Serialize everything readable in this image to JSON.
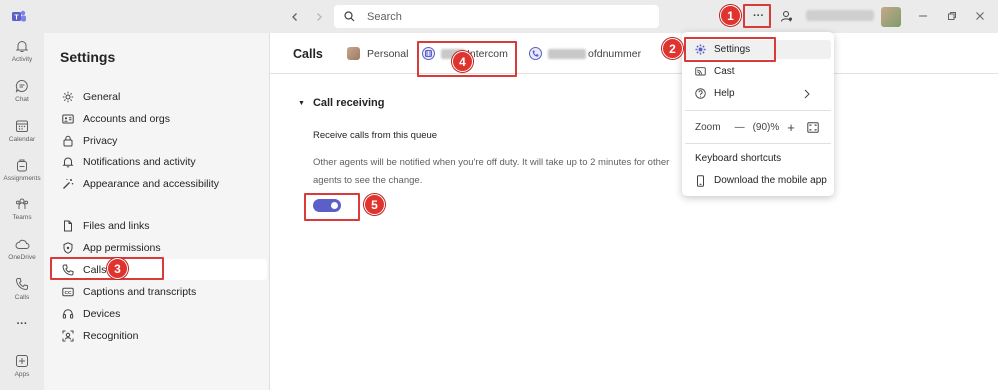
{
  "topbar": {
    "search_placeholder": "Search",
    "more_label": "···"
  },
  "rail": [
    {
      "label": "Activity"
    },
    {
      "label": "Chat"
    },
    {
      "label": "Calendar"
    },
    {
      "label": "Assignments"
    },
    {
      "label": "Teams"
    },
    {
      "label": "OneDrive"
    },
    {
      "label": "Calls"
    },
    {
      "label": "···"
    },
    {
      "label": "Apps"
    }
  ],
  "sidebar": {
    "title": "Settings",
    "items": [
      {
        "label": "General",
        "icon": "gear-icon"
      },
      {
        "label": "Accounts and orgs",
        "icon": "id-card-icon"
      },
      {
        "label": "Privacy",
        "icon": "lock-icon"
      },
      {
        "label": "Notifications and activity",
        "icon": "bell-icon"
      },
      {
        "label": "Appearance and accessibility",
        "icon": "wand-icon"
      },
      {
        "label": "Files and links",
        "icon": "file-icon"
      },
      {
        "label": "App permissions",
        "icon": "shield-icon"
      },
      {
        "label": "Calls",
        "icon": "phone-icon",
        "active": true
      },
      {
        "label": "Captions and transcripts",
        "icon": "cc-icon"
      },
      {
        "label": "Devices",
        "icon": "headset-icon"
      },
      {
        "label": "Recognition",
        "icon": "face-icon"
      }
    ]
  },
  "main": {
    "title": "Calls",
    "tabs": [
      {
        "label": "Personal"
      },
      {
        "label": "Intercom"
      },
      {
        "label": "ofdnummer"
      }
    ],
    "section_title": "Call receiving",
    "queue_label": "Receive calls from this queue",
    "queue_description": "Other agents will be notified when you're off duty. It will take up to 2 minutes for other agents to see the change.",
    "toggle_on": true,
    "accent": "#5b5fc7"
  },
  "menu": {
    "items": [
      {
        "label": "Settings",
        "icon": "gear-icon"
      },
      {
        "label": "Cast",
        "icon": "cast-icon"
      },
      {
        "label": "Help",
        "icon": "help-icon"
      }
    ],
    "zoom_label": "Zoom",
    "zoom_minus": "—",
    "zoom_value": "(90)%",
    "zoom_plus": "+",
    "keyboard_shortcuts": "Keyboard shortcuts",
    "download_app": "Download the mobile app"
  },
  "annotations": {
    "color": "#d93a3a",
    "badges": [
      "1",
      "2",
      "3",
      "4",
      "5"
    ]
  }
}
